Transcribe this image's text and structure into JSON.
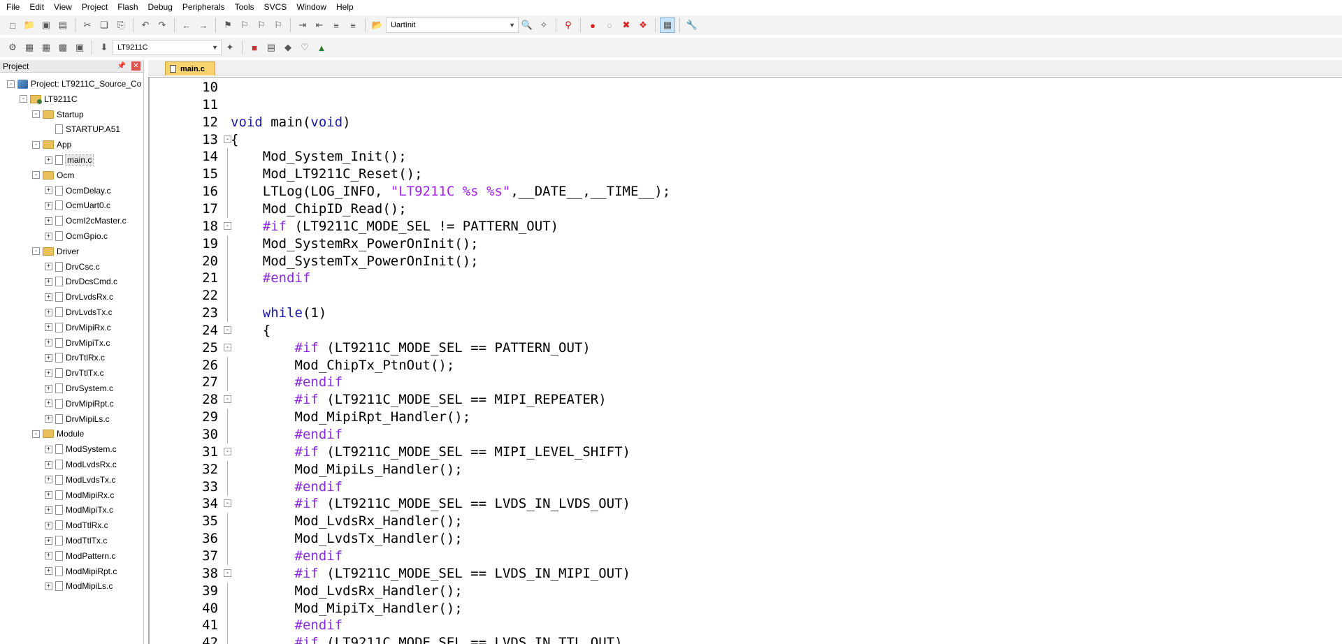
{
  "menubar": {
    "items": [
      "File",
      "Edit",
      "View",
      "Project",
      "Flash",
      "Debug",
      "Peripherals",
      "Tools",
      "SVCS",
      "Window",
      "Help"
    ]
  },
  "toolbar": {
    "uart_combo": "UartInit",
    "target_combo": "LT9211C"
  },
  "project_panel": {
    "title": "Project",
    "project_label": "Project: LT9211C_Source_Co",
    "target_label": "LT9211C",
    "groups": [
      {
        "name": "Startup",
        "files": [
          "STARTUP.A51"
        ]
      },
      {
        "name": "App",
        "files": [
          "main.c"
        ]
      },
      {
        "name": "Ocm",
        "files": [
          "OcmDelay.c",
          "OcmUart0.c",
          "OcmI2cMaster.c",
          "OcmGpio.c"
        ]
      },
      {
        "name": "Driver",
        "files": [
          "DrvCsc.c",
          "DrvDcsCmd.c",
          "DrvLvdsRx.c",
          "DrvLvdsTx.c",
          "DrvMipiRx.c",
          "DrvMipiTx.c",
          "DrvTtlRx.c",
          "DrvTtlTx.c",
          "DrvSystem.c",
          "DrvMipiRpt.c",
          "DrvMipiLs.c"
        ]
      },
      {
        "name": "Module",
        "files": [
          "ModSystem.c",
          "ModLvdsRx.c",
          "ModLvdsTx.c",
          "ModMipiRx.c",
          "ModMipiTx.c",
          "ModTtlRx.c",
          "ModTtlTx.c",
          "ModPattern.c",
          "ModMipiRpt.c",
          "ModMipiLs.c"
        ]
      }
    ]
  },
  "editor": {
    "tab_label": "main.c",
    "lines": [
      {
        "n": "10",
        "t": ""
      },
      {
        "n": "11",
        "t": ""
      },
      {
        "n": "12",
        "t": "void main(void)"
      },
      {
        "n": "13",
        "t": "{"
      },
      {
        "n": "14",
        "t": "    Mod_System_Init();"
      },
      {
        "n": "15",
        "t": "    Mod_LT9211C_Reset();"
      },
      {
        "n": "16",
        "t": "    LTLog(LOG_INFO, \"LT9211C %s %s\",__DATE__,__TIME__);"
      },
      {
        "n": "17",
        "t": "    Mod_ChipID_Read();"
      },
      {
        "n": "18",
        "t": "    #if (LT9211C_MODE_SEL != PATTERN_OUT)"
      },
      {
        "n": "19",
        "t": "    Mod_SystemRx_PowerOnInit();"
      },
      {
        "n": "20",
        "t": "    Mod_SystemTx_PowerOnInit();"
      },
      {
        "n": "21",
        "t": "    #endif"
      },
      {
        "n": "22",
        "t": ""
      },
      {
        "n": "23",
        "t": "    while(1)"
      },
      {
        "n": "24",
        "t": "    {"
      },
      {
        "n": "25",
        "t": "        #if (LT9211C_MODE_SEL == PATTERN_OUT)"
      },
      {
        "n": "26",
        "t": "        Mod_ChipTx_PtnOut();"
      },
      {
        "n": "27",
        "t": "        #endif"
      },
      {
        "n": "28",
        "t": "        #if (LT9211C_MODE_SEL == MIPI_REPEATER)"
      },
      {
        "n": "29",
        "t": "        Mod_MipiRpt_Handler();"
      },
      {
        "n": "30",
        "t": "        #endif"
      },
      {
        "n": "31",
        "t": "        #if (LT9211C_MODE_SEL == MIPI_LEVEL_SHIFT)"
      },
      {
        "n": "32",
        "t": "        Mod_MipiLs_Handler();"
      },
      {
        "n": "33",
        "t": "        #endif"
      },
      {
        "n": "34",
        "t": "        #if (LT9211C_MODE_SEL == LVDS_IN_LVDS_OUT)"
      },
      {
        "n": "35",
        "t": "        Mod_LvdsRx_Handler();"
      },
      {
        "n": "36",
        "t": "        Mod_LvdsTx_Handler();"
      },
      {
        "n": "37",
        "t": "        #endif"
      },
      {
        "n": "38",
        "t": "        #if (LT9211C_MODE_SEL == LVDS_IN_MIPI_OUT)"
      },
      {
        "n": "39",
        "t": "        Mod_LvdsRx_Handler();"
      },
      {
        "n": "40",
        "t": "        Mod_MipiTx_Handler();"
      },
      {
        "n": "41",
        "t": "        #endif"
      },
      {
        "n": "42",
        "t": "        #if (LT9211C_MODE_SEL == LVDS_IN_TTL_OUT)"
      }
    ],
    "fold_lines": [
      "13",
      "18",
      "24",
      "25",
      "28",
      "31",
      "34",
      "38"
    ]
  },
  "icons": {
    "new_file": "new-file-icon",
    "open": "open-folder-icon",
    "save": "save-icon",
    "build": "build-icon",
    "debug": "debug-icon"
  }
}
